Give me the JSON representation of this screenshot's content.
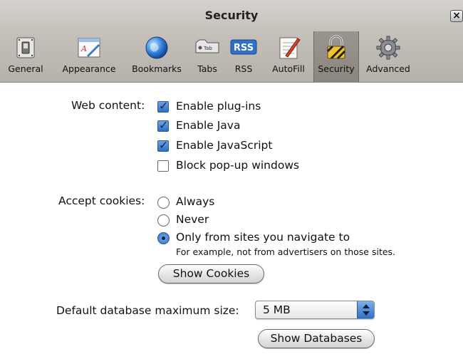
{
  "window": {
    "title": "Security",
    "close_glyph": "×"
  },
  "toolbar": {
    "items": [
      {
        "label": "General",
        "icon": "general-switch-icon",
        "selected": false
      },
      {
        "label": "Appearance",
        "icon": "appearance-icon",
        "selected": false
      },
      {
        "label": "Bookmarks",
        "icon": "bookmarks-globe-icon",
        "selected": false
      },
      {
        "label": "Tabs",
        "icon": "tabs-icon",
        "selected": false
      },
      {
        "label": "RSS",
        "icon": "rss-icon",
        "selected": false
      },
      {
        "label": "AutoFill",
        "icon": "autofill-pencil-icon",
        "selected": false
      },
      {
        "label": "Security",
        "icon": "security-lock-icon",
        "selected": true
      },
      {
        "label": "Advanced",
        "icon": "advanced-gear-icon",
        "selected": false
      }
    ],
    "tabs_icon_text": "Tab",
    "rss_icon_text": "RSS"
  },
  "web_content": {
    "label": "Web content:",
    "options": [
      {
        "label": "Enable plug-ins",
        "checked": true
      },
      {
        "label": "Enable Java",
        "checked": true
      },
      {
        "label": "Enable JavaScript",
        "checked": true
      },
      {
        "label": "Block pop-up windows",
        "checked": false
      }
    ]
  },
  "cookies": {
    "label": "Accept cookies:",
    "options": [
      {
        "label": "Always",
        "selected": false
      },
      {
        "label": "Never",
        "selected": false
      },
      {
        "label": "Only from sites you navigate to",
        "selected": true
      }
    ],
    "note": "For example, not from advertisers on those sites.",
    "show_button": "Show Cookies"
  },
  "database": {
    "label": "Default database maximum size:",
    "value": "5 MB",
    "show_button": "Show Databases"
  },
  "colors": {
    "accent": "#2f6fc6",
    "chrome": "#c6c2bb",
    "selected_tab": "#8a857e"
  }
}
